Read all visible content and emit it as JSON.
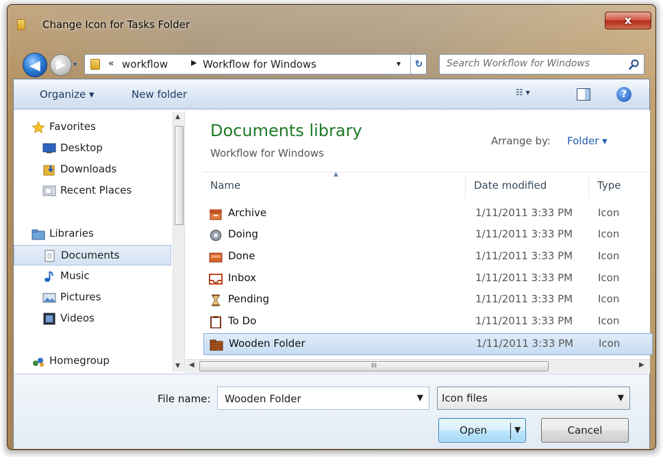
{
  "window": {
    "title": "Change Icon for Tasks Folder",
    "close_label": "x"
  },
  "nav_bar": {
    "back_label": "◀",
    "forward_label": "▶",
    "history_label": "▾",
    "address": {
      "chevrons": "«",
      "segments": [
        "workflow",
        "Workflow for Windows"
      ],
      "separator": "▶",
      "dropdown": "▾",
      "refresh": "↻"
    },
    "search": {
      "placeholder": "Search Workflow for Windows"
    }
  },
  "toolbar": {
    "organize": "Organize ▾",
    "new_folder": "New folder",
    "views": "☷ ▾",
    "help": "?"
  },
  "sidebar": {
    "items": [
      {
        "label": "Favorites",
        "icon": "star-icon",
        "group": true
      },
      {
        "label": "Desktop",
        "icon": "desktop-icon"
      },
      {
        "label": "Downloads",
        "icon": "downloads-icon"
      },
      {
        "label": "Recent Places",
        "icon": "recent-places-icon"
      },
      {
        "label": "Libraries",
        "icon": "libraries-icon",
        "group": true
      },
      {
        "label": "Documents",
        "icon": "documents-icon",
        "selected": true
      },
      {
        "label": "Music",
        "icon": "music-icon"
      },
      {
        "label": "Pictures",
        "icon": "pictures-icon"
      },
      {
        "label": "Videos",
        "icon": "videos-icon"
      },
      {
        "label": "Homegroup",
        "icon": "homegroup-icon",
        "group": true
      }
    ],
    "scroll_up": "▲",
    "scroll_down": "▼"
  },
  "content": {
    "library_title": "Documents library",
    "library_subtitle": "Workflow for Windows",
    "arrange_label": "Arrange by:",
    "arrange_value": "Folder ▾",
    "columns": [
      "Name",
      "Date modified",
      "Type"
    ],
    "sort_indicator": "▲",
    "rows": [
      {
        "name": "Archive",
        "date": "1/11/2011 3:33 PM",
        "type": "Icon",
        "icon": "archive-icon"
      },
      {
        "name": "Doing",
        "date": "1/11/2011 3:33 PM",
        "type": "Icon",
        "icon": "doing-icon"
      },
      {
        "name": "Done",
        "date": "1/11/2011 3:33 PM",
        "type": "Icon",
        "icon": "done-icon"
      },
      {
        "name": "Inbox",
        "date": "1/11/2011 3:33 PM",
        "type": "Icon",
        "icon": "inbox-icon"
      },
      {
        "name": "Pending",
        "date": "1/11/2011 3:33 PM",
        "type": "Icon",
        "icon": "hourglass-icon"
      },
      {
        "name": "To Do",
        "date": "1/11/2011 3:33 PM",
        "type": "Icon",
        "icon": "clipboard-icon"
      },
      {
        "name": "Wooden Folder",
        "date": "1/11/2011 3:33 PM",
        "type": "Icon",
        "icon": "wooden-folder-icon",
        "selected": true
      }
    ],
    "hscroll_grip": "III",
    "hscroll_left": "◀",
    "hscroll_right": "▶"
  },
  "footer": {
    "file_name_label": "File name:",
    "file_name_value": "Wooden Folder",
    "file_type_value": "Icon files",
    "dropdown": "▼",
    "open_label": "Open",
    "cancel_label": "Cancel",
    "resize_grip": "⋰"
  },
  "colors": {
    "library_title": "#1e7a27",
    "link_blue": "#1f5cb3",
    "selection": "#c7dcf3",
    "close_red": "#cf5a44"
  }
}
